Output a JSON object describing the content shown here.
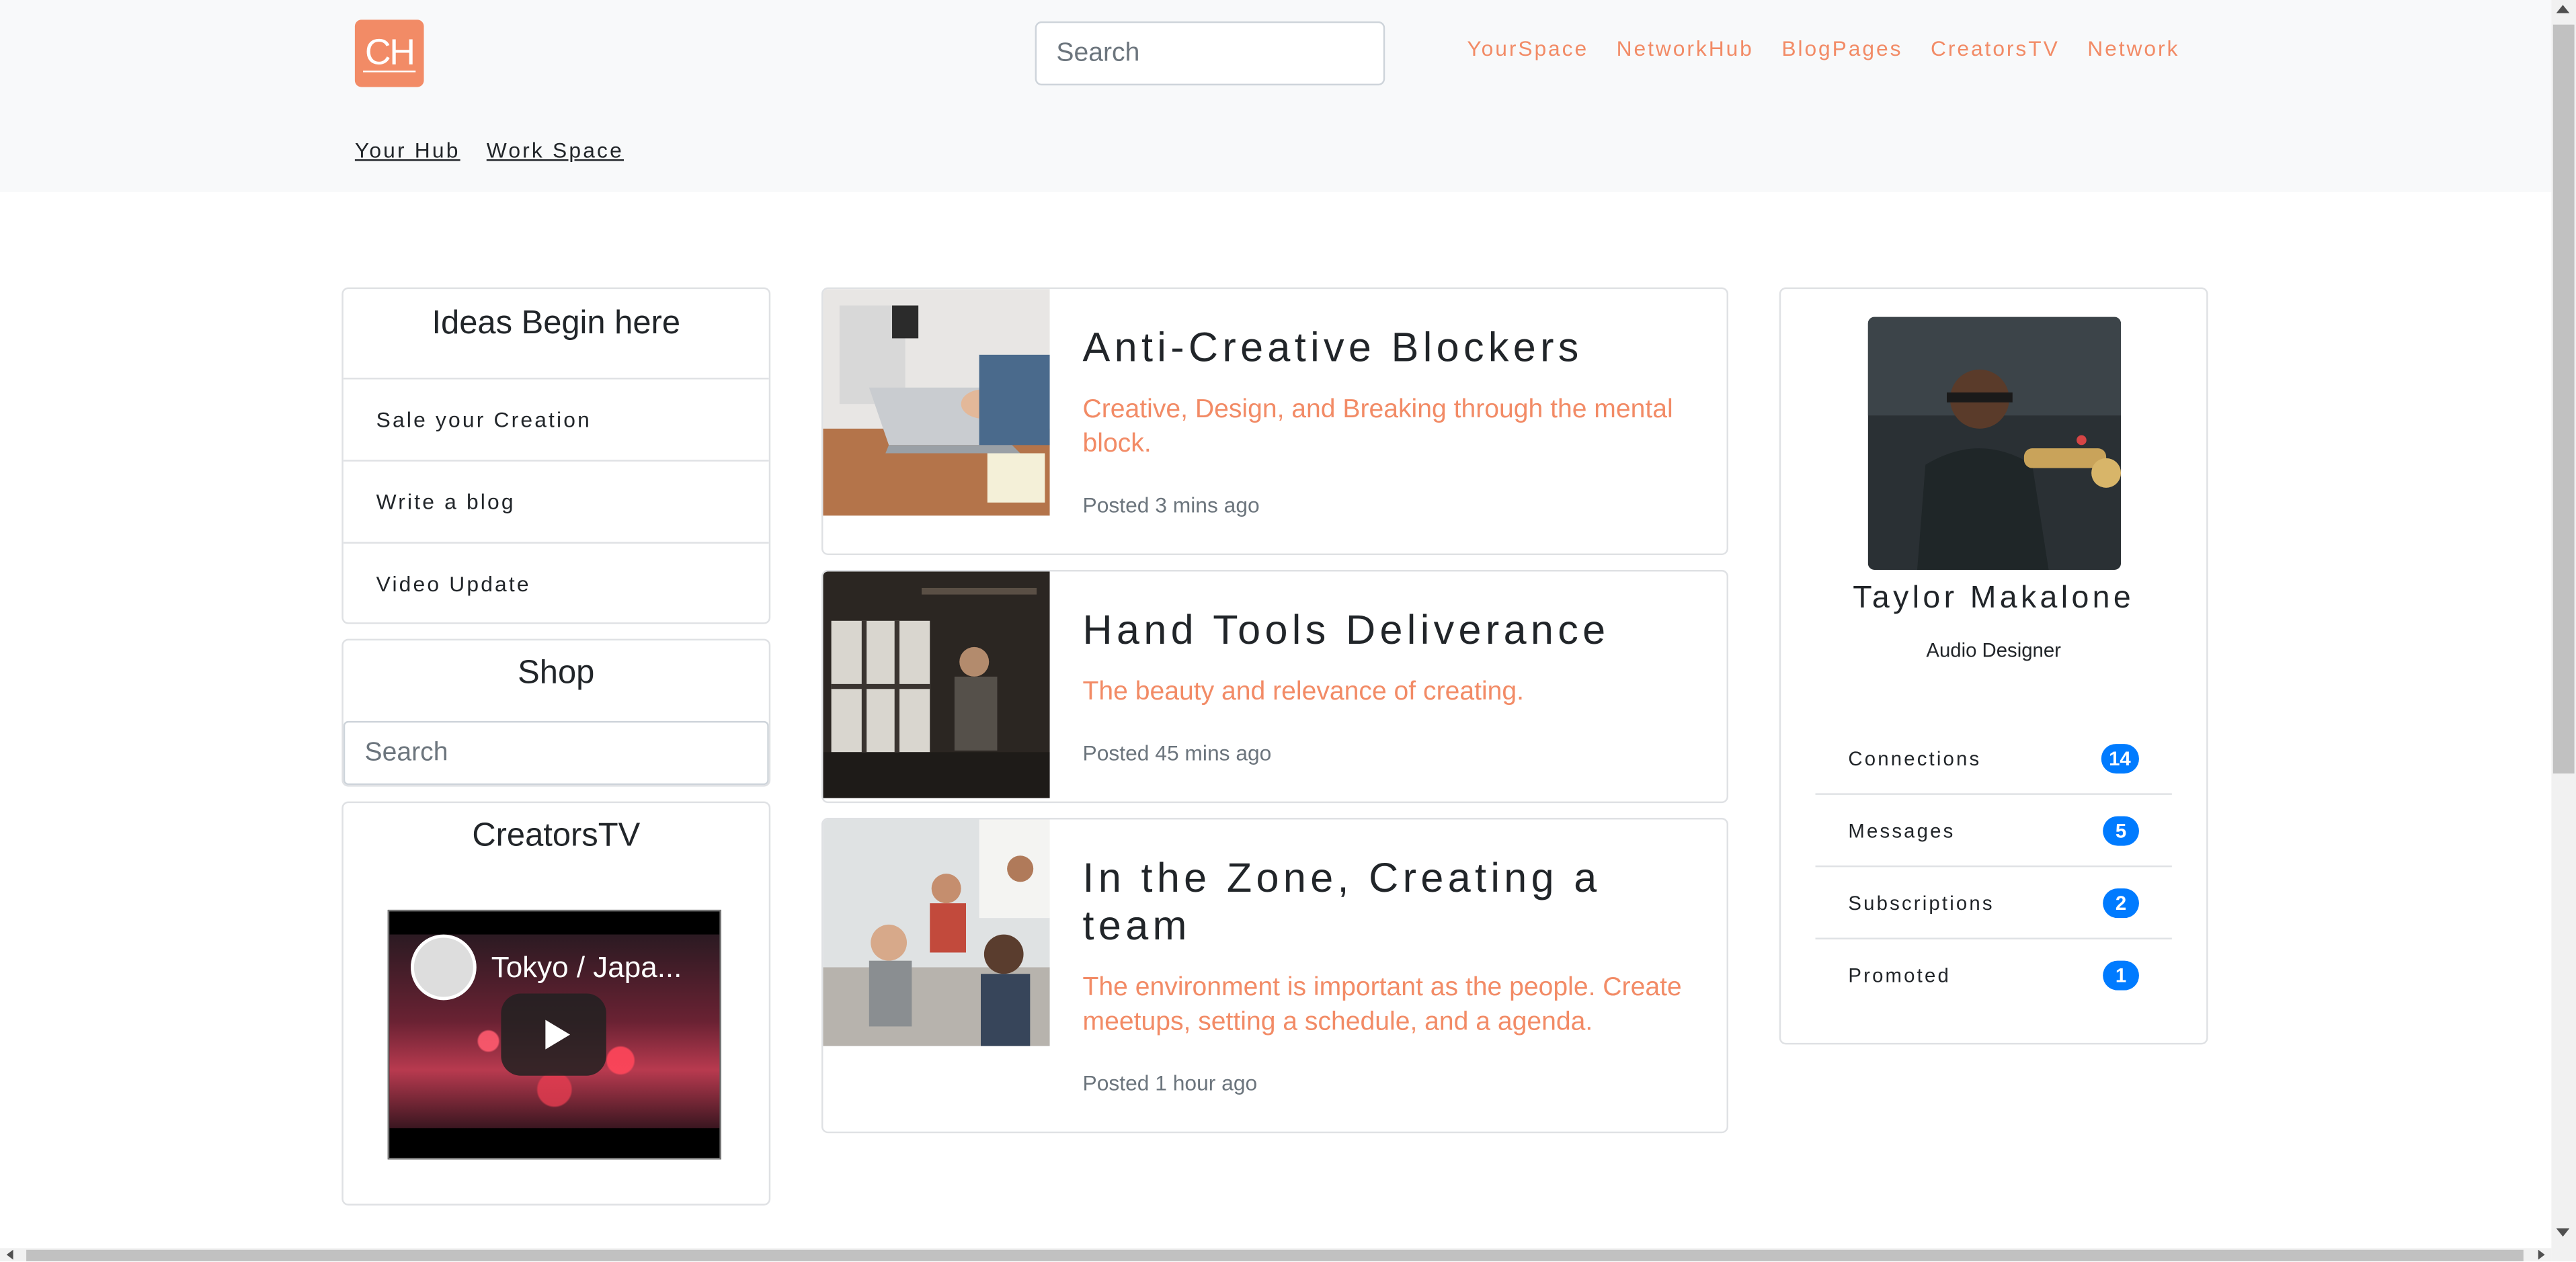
{
  "nav": {
    "logo": "CH",
    "search_placeholder": "Search",
    "links": [
      "YourSpace",
      "NetworkHub",
      "BlogPages",
      "CreatorsTV",
      "Network"
    ],
    "sub_links": [
      "Your Hub",
      "Work Space"
    ]
  },
  "left": {
    "ideas_title": "Ideas Begin here",
    "ideas_items": [
      "Sale your Creation",
      "Write a blog",
      "Video Update"
    ],
    "shop_title": "Shop",
    "shop_search_placeholder": "Search",
    "tv_title": "CreatorsTV",
    "video_title": "Tokyo / Japa..."
  },
  "posts": [
    {
      "title": "Anti-Creative Blockers",
      "subtitle": "Creative, Design, and Breaking through the mental block.",
      "time": "Posted 3 mins ago"
    },
    {
      "title": "Hand Tools Deliverance",
      "subtitle": "The beauty and relevance of creating.",
      "time": "Posted 45 mins ago"
    },
    {
      "title": "In the Zone, Creating a team",
      "subtitle": "The environment is important as the people. Create meetups, setting a schedule, and a agenda.",
      "time": "Posted 1 hour ago"
    }
  ],
  "profile": {
    "name": "Taylor Makalone",
    "role": "Audio Designer",
    "stats": [
      {
        "label": "Connections",
        "count": "14"
      },
      {
        "label": "Messages",
        "count": "5"
      },
      {
        "label": "Subscriptions",
        "count": "2"
      },
      {
        "label": "Promoted",
        "count": "1"
      }
    ]
  },
  "colors": {
    "accent": "#f28b66",
    "badge": "#007bff",
    "navbar_bg": "#f8f9fa"
  }
}
